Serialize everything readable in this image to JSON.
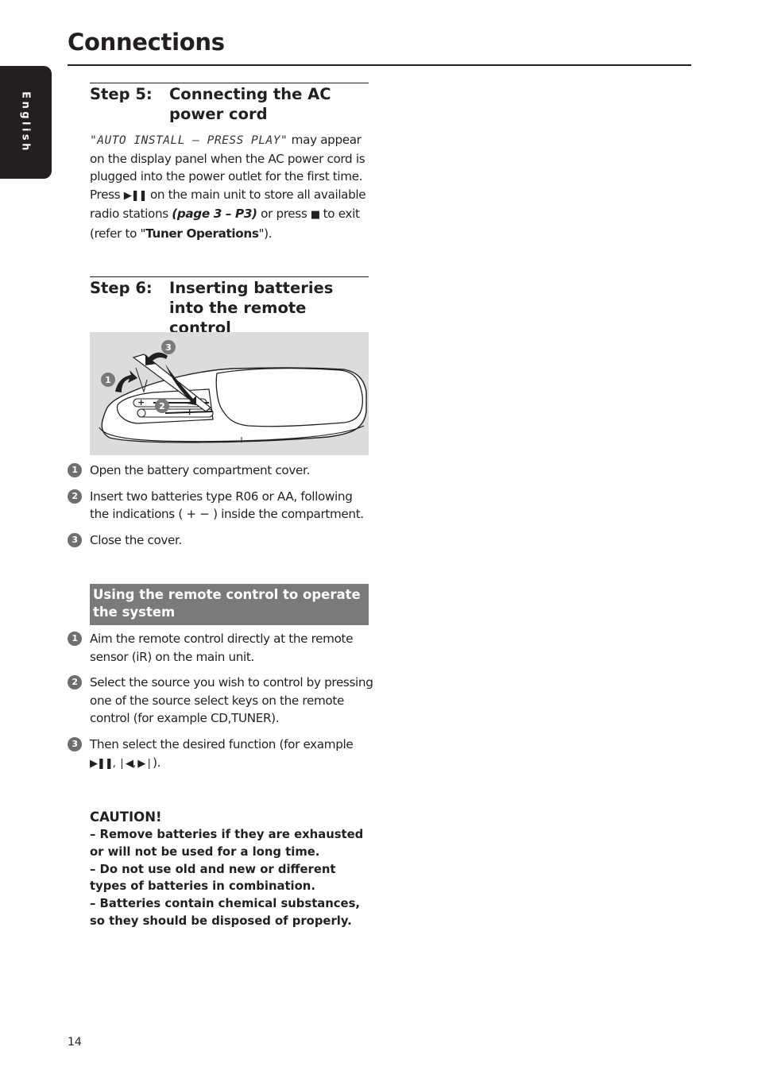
{
  "page": {
    "title": "Connections",
    "language_tab": "English",
    "page_number": "14"
  },
  "step5": {
    "number": "Step 5:",
    "title": "Connecting the AC power cord",
    "display_text": "\"AUTO INSTALL – PRESS PLAY\"",
    "text_1": " may appear on the display panel when the AC power cord is plugged into the power outlet for the first time. Press ",
    "play_pause_glyph": "▶❚❚",
    "text_2": " on the main unit to store all available radio stations ",
    "page_ref": "(page 3 – P3)",
    "text_3": " or press ",
    "stop_glyph": "■",
    "text_4": " to exit (refer to \"",
    "tuner_ref": "Tuner Operations",
    "text_5": "\")."
  },
  "step6": {
    "number": "Step 6:",
    "title": "Inserting batteries into the remote control",
    "illustration": {
      "description": "Remote control with battery compartment cover opened, two batteries inserted",
      "callouts": [
        "1",
        "2",
        "3"
      ]
    },
    "steps": [
      {
        "badge": "1",
        "text": "Open the battery compartment cover."
      },
      {
        "badge": "2",
        "text": "Insert two batteries type R06 or AA, following the indications ( + − ) inside the compartment."
      },
      {
        "badge": "3",
        "text": "Close the cover."
      }
    ]
  },
  "remote_usage": {
    "heading": "Using the remote control to operate the system",
    "steps": [
      {
        "badge": "1",
        "text": "Aim the remote control directly at the remote sensor (iR) on the main unit."
      },
      {
        "badge": "2",
        "text": "Select the source you wish to control by pressing one of the source select keys on the remote control (for example CD,TUNER)."
      },
      {
        "badge": "3",
        "text": "Then select the desired function (for example ",
        "glyphs": "▶❚❚, ❘◀, ▶❘",
        "text_end": ")."
      }
    ]
  },
  "caution": {
    "heading": "CAUTION!",
    "items": [
      "–  Remove batteries if they are exhausted or will not be used for a long time.",
      "–  Do not use old and new or different types of batteries in combination.",
      "–  Batteries contain chemical substances, so they should be disposed of properly."
    ]
  }
}
